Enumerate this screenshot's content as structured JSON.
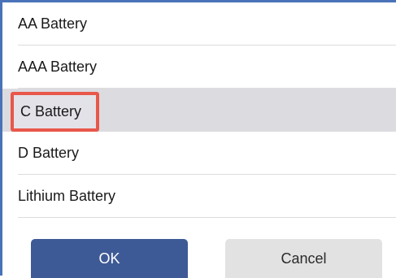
{
  "battery_list": {
    "items": [
      {
        "label": "AA Battery"
      },
      {
        "label": "AAA Battery"
      },
      {
        "label": "C Battery"
      },
      {
        "label": "D Battery"
      },
      {
        "label": "Lithium Battery"
      }
    ],
    "selected_index": 2
  },
  "actions": {
    "ok_label": "OK",
    "cancel_label": "Cancel"
  },
  "colors": {
    "frame_border": "#4a72b8",
    "selected_row": "#dcdbe0",
    "highlight_outline": "#e8574a",
    "ok_button": "#3e5a96",
    "cancel_button": "#e2e2e2"
  }
}
